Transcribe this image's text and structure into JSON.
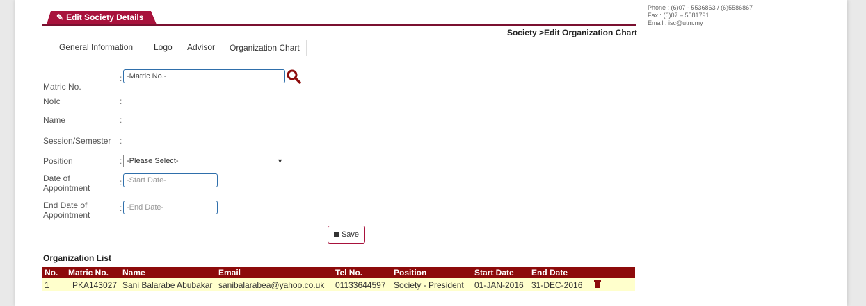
{
  "header": {
    "title": "Edit Society Details",
    "breadcrumb": "Society >Edit Organization Chart"
  },
  "contact": {
    "phone": "Phone : (6)07 - 5536863 / (6)5586867",
    "fax": "Fax : (6)07 – 5581791",
    "email": "Email : isc@utm.my"
  },
  "tabs": [
    {
      "label": "General Information"
    },
    {
      "label": "Logo"
    },
    {
      "label": "Advisor"
    },
    {
      "label": "Organization Chart",
      "active": true
    }
  ],
  "form": {
    "colon": ":",
    "matric": {
      "label": "Matric No.",
      "placeholder": "-Matric No.-"
    },
    "noic": {
      "label": "NoIc"
    },
    "name": {
      "label": "Name"
    },
    "session": {
      "label": "Session/Semester"
    },
    "position": {
      "label": "Position",
      "selected": "-Please Select-"
    },
    "date_appointment": {
      "label_line1": "Date of",
      "label_line2": "Appointment",
      "placeholder": "-Start Date-"
    },
    "end_date": {
      "label_line1": "End Date of",
      "label_line2": "Appointment",
      "placeholder": "-End Date-"
    },
    "save_label": "Save"
  },
  "organization_list": {
    "title": "Organization List",
    "columns": [
      "No.",
      "Matric No.",
      "Name",
      "Email",
      "Tel No.",
      "Position",
      "Start Date",
      "End Date"
    ],
    "rows": [
      [
        "1",
        "PKA143027",
        "Sani Balarabe Abubakar",
        "sanibalarabea@yahoo.co.uk",
        "01133644597",
        "Society - President",
        "01-JAN-2016",
        "31-DEC-2016"
      ]
    ]
  },
  "colors": {
    "accent": "#a8123c",
    "table_header": "#8d0b0b",
    "row_bg": "#ffffcc",
    "input_border": "#2f6fab"
  },
  "icons": {
    "title": "edit-icon",
    "search": "search-icon",
    "save": "save-icon",
    "delete": "trash-icon"
  }
}
